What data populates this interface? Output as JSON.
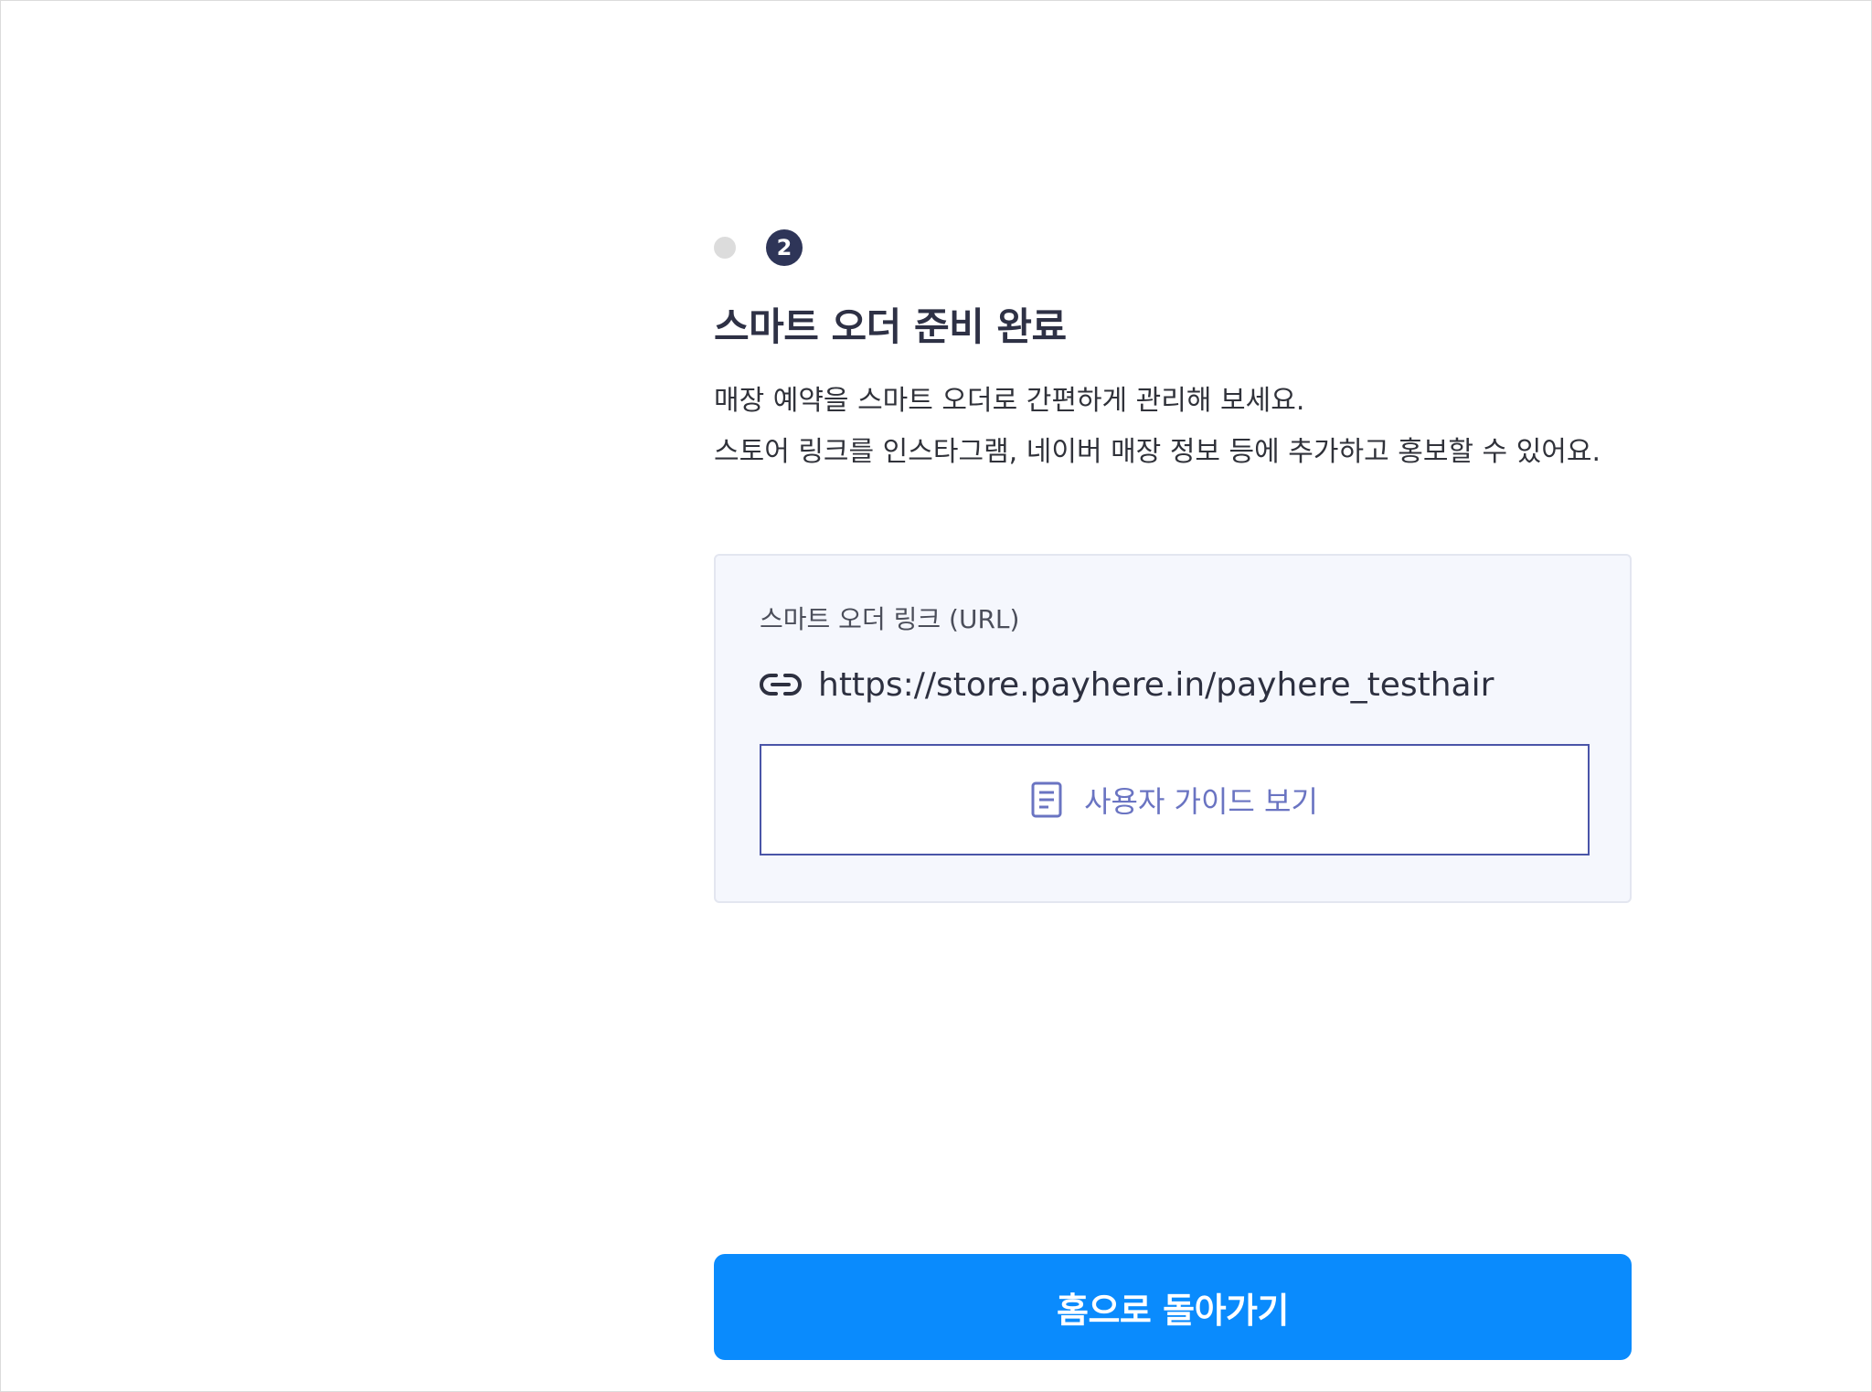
{
  "stepper": {
    "current_step": "2"
  },
  "title": "스마트 오더 준비 완료",
  "description": {
    "line1": "매장 예약을 스마트 오더로 간편하게 관리해 보세요.",
    "line2": "스토어 링크를 인스타그램, 네이버 매장 정보 등에 추가하고 홍보할 수 있어요."
  },
  "link_card": {
    "label": "스마트 오더 링크 (URL)",
    "url": "https://store.payhere.in/payhere_testhair",
    "link_icon": "link-icon",
    "guide_button_label": "사용자 가이드 보기",
    "guide_icon": "document-icon"
  },
  "home_button_label": "홈으로 돌아가기",
  "colors": {
    "step_active": "#2e3558",
    "step_inactive": "#dcdcdc",
    "card_background": "#f5f7fd",
    "guide_button_border": "#4a55a8",
    "guide_button_text": "#6a74c2",
    "primary_button": "#0a8bfd"
  }
}
